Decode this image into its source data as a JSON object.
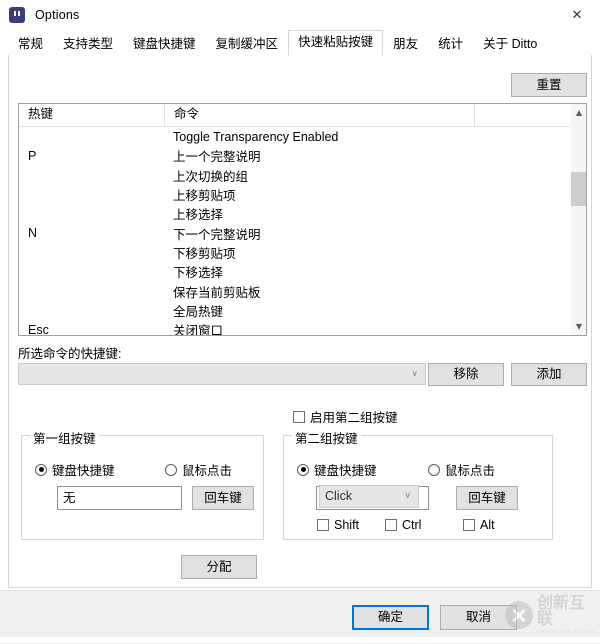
{
  "window": {
    "title": "Options",
    "app_icon": "ditto-quote-icon",
    "close_icon": "close-icon"
  },
  "tabs": [
    {
      "label": "常规",
      "selected": false
    },
    {
      "label": "支持类型",
      "selected": false
    },
    {
      "label": "键盘快捷键",
      "selected": false
    },
    {
      "label": "复制缓冲区",
      "selected": false
    },
    {
      "label": "快速粘贴按键",
      "selected": true
    },
    {
      "label": "朋友",
      "selected": false
    },
    {
      "label": "统计",
      "selected": false
    },
    {
      "label": "关于 Ditto",
      "selected": false
    }
  ],
  "toolbar": {
    "reset_label": "重置"
  },
  "list": {
    "columns": [
      "热键",
      "命令",
      ""
    ],
    "rows": [
      {
        "hotkey": "",
        "command": "Toggle Transparency Enabled"
      },
      {
        "hotkey": "P",
        "command": "上一个完整说明"
      },
      {
        "hotkey": "",
        "command": "上次切换的组"
      },
      {
        "hotkey": "",
        "command": "上移剪贴项"
      },
      {
        "hotkey": "",
        "command": "上移选择"
      },
      {
        "hotkey": "N",
        "command": "下一个完整说明"
      },
      {
        "hotkey": "",
        "command": "下移剪贴项"
      },
      {
        "hotkey": "",
        "command": "下移选择"
      },
      {
        "hotkey": "",
        "command": "保存当前剪贴板"
      },
      {
        "hotkey": "",
        "command": "全局热键"
      },
      {
        "hotkey": "Esc",
        "command": "关闭窗口"
      }
    ],
    "scroll_up_icon": "chevron-up-icon",
    "scroll_down_icon": "chevron-down-icon"
  },
  "shortcut": {
    "label": "所选命令的快捷键:",
    "combo_value": "",
    "combo_arrow_icon": "chevron-down-icon",
    "remove_label": "移除",
    "add_label": "添加"
  },
  "second_set": {
    "checkbox_label": "启用第二组按键",
    "checked": false
  },
  "group1": {
    "title": "第一组按键",
    "radio_keyboard": "键盘快捷键",
    "radio_mouse": "鼠标点击",
    "keyboard_selected": true,
    "key_value": "无",
    "enter_label": "回车键"
  },
  "group2": {
    "title": "第二组按键",
    "radio_keyboard": "键盘快捷键",
    "radio_mouse": "鼠标点击",
    "keyboard_selected": true,
    "combo_value": "Click",
    "combo_arrow_icon": "chevron-down-icon",
    "enter_label": "回车键",
    "modifiers": [
      {
        "label": "Shift",
        "checked": false
      },
      {
        "label": "Ctrl",
        "checked": false
      },
      {
        "label": "Alt",
        "checked": false
      }
    ]
  },
  "assign": {
    "label": "分配"
  },
  "footer": {
    "ok_label": "确定",
    "cancel_label": "取消"
  },
  "watermark": {
    "cn": "创新互联",
    "en": "CHUANG XIN HU LIAN"
  },
  "colors": {
    "accent": "#0078d7",
    "button_face": "#e1e1e1",
    "button_border": "#adadad",
    "disabled_field": "#e6e6e6",
    "scroll_thumb": "#cdcdcd"
  }
}
